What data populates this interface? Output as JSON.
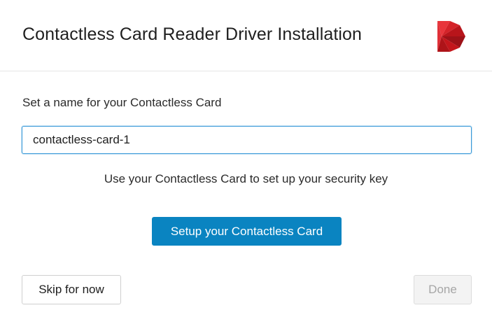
{
  "header": {
    "title": "Contactless Card Reader Driver Installation",
    "logo_icon": "brand-d-logo-icon",
    "logo_colors": [
      "#e8353b",
      "#c4161c",
      "#8e0f14"
    ]
  },
  "form": {
    "name_label": "Set a name for your Contactless Card",
    "name_value": "contactless-card-1",
    "hint": "Use your Contactless Card to set up your security key",
    "setup_label": "Setup your Contactless Card"
  },
  "footer": {
    "skip_label": "Skip for now",
    "done_label": "Done"
  },
  "colors": {
    "primary": "#0a84c1",
    "input_focus_border": "#3a9ad9",
    "disabled_text": "#a6a6a6"
  }
}
